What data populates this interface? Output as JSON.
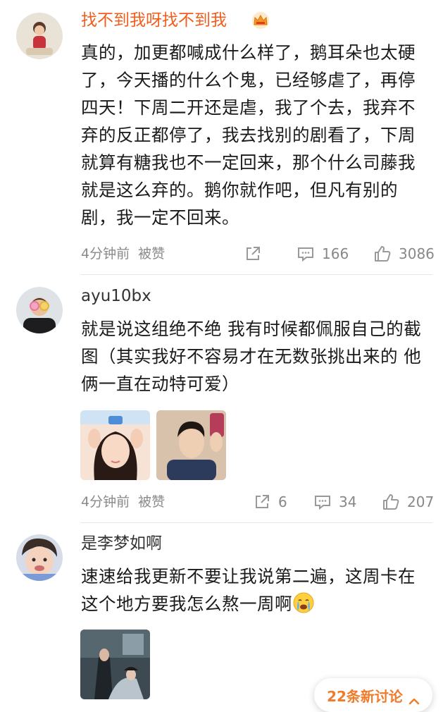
{
  "comments": [
    {
      "username": "找不到我呀找不到我",
      "content": "真的，加更都喊成什么样了，鹅耳朵也太硬了，今天播的什么个鬼，已经够虐了，再停四天！下周二开还是虐，我了个去，我弃不弃的反正都停了，我去找别的剧看了，下周就算有糖我也不一定回来，那个什么司藤我就是这么弃的。鹅你就作吧，但凡有别的剧，我一定不回来。",
      "time": "4分钟前",
      "tag": "被赞",
      "reply_count": "166",
      "like_count": "3086"
    },
    {
      "username": "ayu10bx",
      "content": "就是说这组绝不绝 我有时候都佩服自己的截图（其实我好不容易才在无数张挑出来的 他俩一直在动特可爱）",
      "time": "4分钟前",
      "tag": "被赞",
      "share_count": "6",
      "reply_count": "34",
      "like_count": "207"
    },
    {
      "username": "是李梦如啊",
      "content": "速速给我更新不要让我说第二遍，这周卡在这个地方要我怎么熬一周啊"
    }
  ],
  "more_discussion": "22条新讨论",
  "icons": {
    "crown": "crown-icon",
    "share": "share-icon",
    "comment": "comment-icon",
    "like": "thumbs-up-icon",
    "emoji": "crying-emoji-icon",
    "chevron": "chevron-up-icon"
  },
  "colors": {
    "vip_name": "#f25d1b",
    "meta": "#8a8a8a",
    "more_button": "#f07b2a"
  }
}
